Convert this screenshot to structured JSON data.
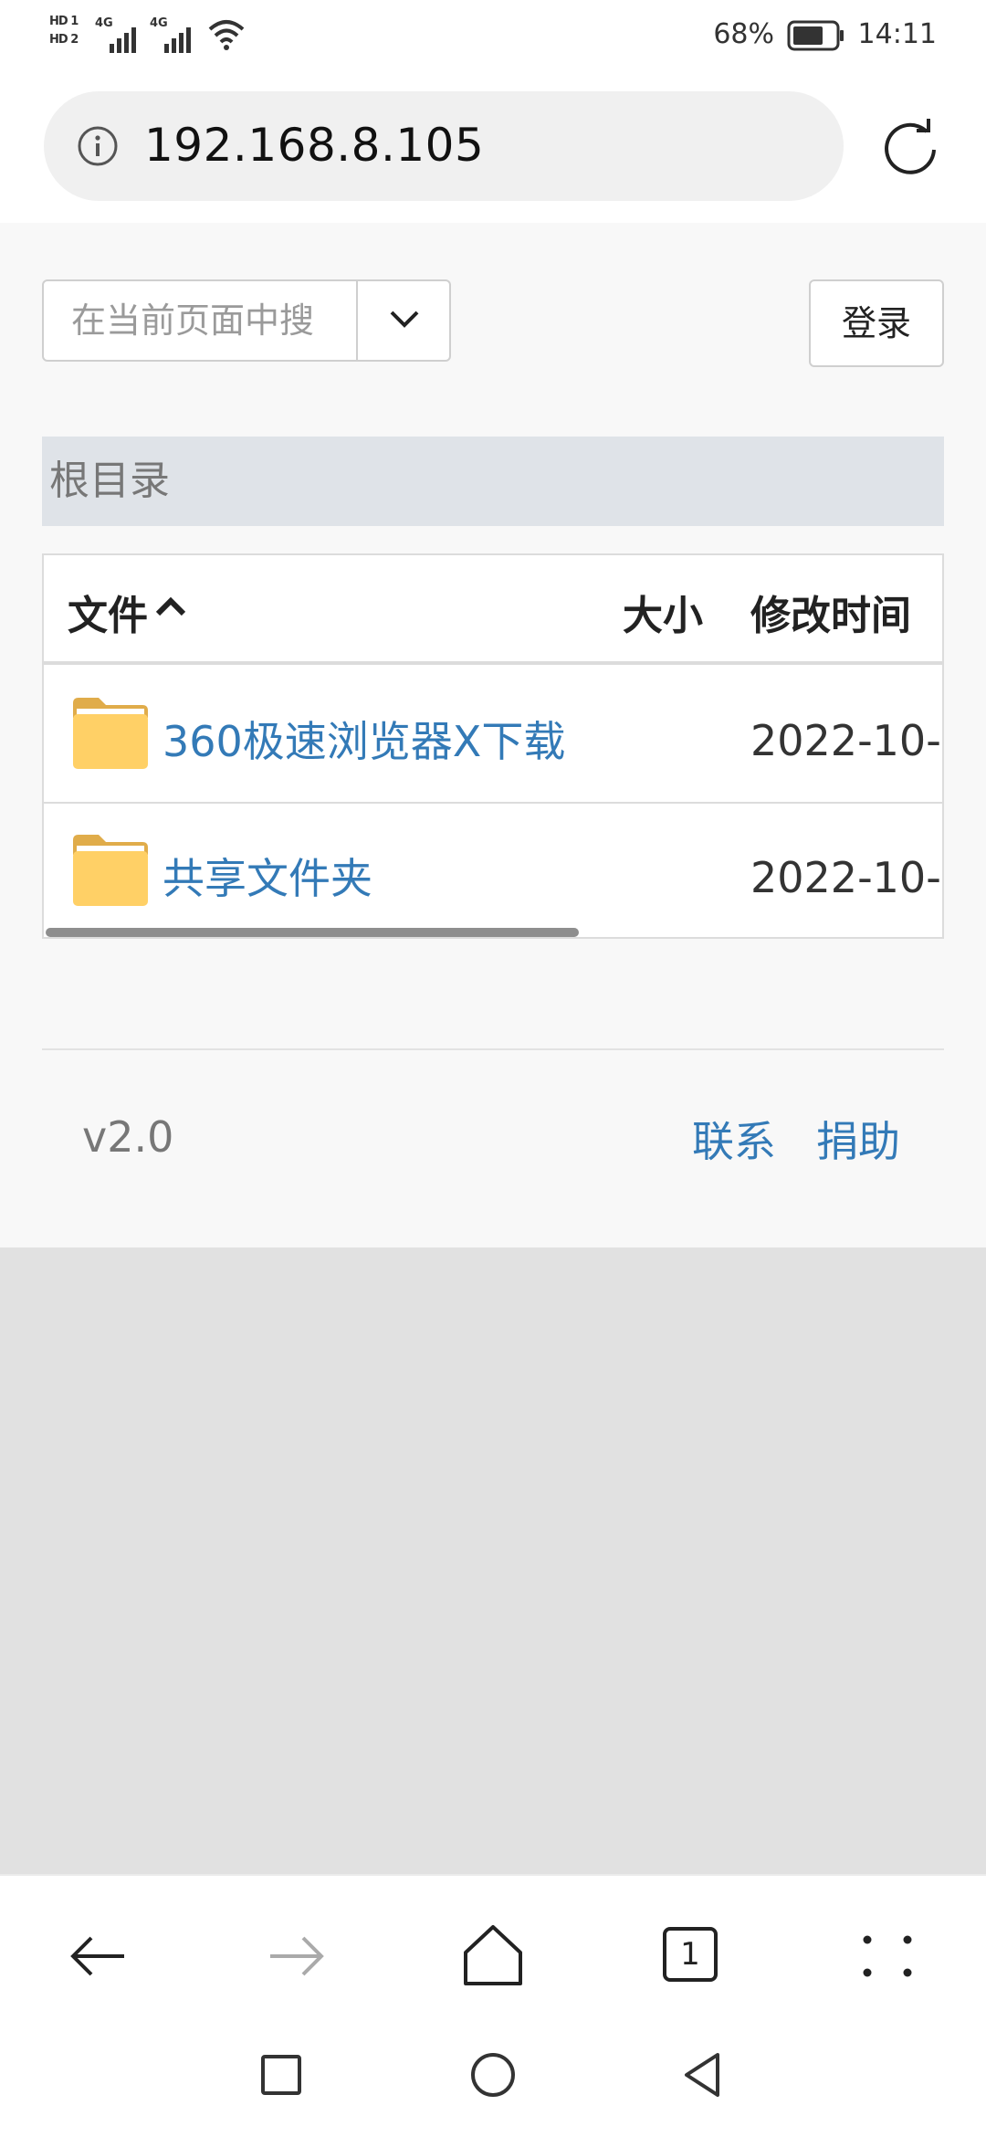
{
  "status_bar": {
    "sim1_label": "HD 1",
    "sim2_label": "HD 2",
    "network1": "4G",
    "network2": "4G",
    "battery_percent": "68%",
    "time": "14:11"
  },
  "address_bar": {
    "url": "192.168.8.105",
    "info_icon": "info-icon",
    "reload_icon": "reload-icon"
  },
  "page": {
    "search": {
      "placeholder": "在当前页面中搜",
      "dropdown_icon": "chevron-down-icon"
    },
    "login_label": "登录",
    "breadcrumb": "根目录",
    "table": {
      "headers": {
        "name": "文件",
        "size": "大小",
        "modified": "修改时间"
      },
      "sort_icon": "chevron-up-icon",
      "rows": [
        {
          "name": "360极速浏览器X下载",
          "size": "",
          "modified": "2022-10-",
          "icon": "folder-icon"
        },
        {
          "name": "共享文件夹",
          "size": "",
          "modified": "2022-10-",
          "icon": "folder-icon"
        }
      ]
    },
    "footer": {
      "version": "v2.0",
      "contact_label": "联系",
      "donate_label": "捐助"
    }
  },
  "toolbar": {
    "open_tabs": "1",
    "icons": [
      "back-arrow-icon",
      "forward-arrow-icon",
      "home-icon",
      "tabs-icon",
      "menu-dots-icon"
    ]
  },
  "system_nav": {
    "icons": [
      "recent-apps-icon",
      "home-circle-icon",
      "back-triangle-icon"
    ]
  },
  "colors": {
    "link": "#337ab7",
    "folder": "#ffd066",
    "breadcrumb_bg": "#dfe3e8",
    "page_bg": "#f8f8f8",
    "outer_bg": "#e1e1e1"
  }
}
